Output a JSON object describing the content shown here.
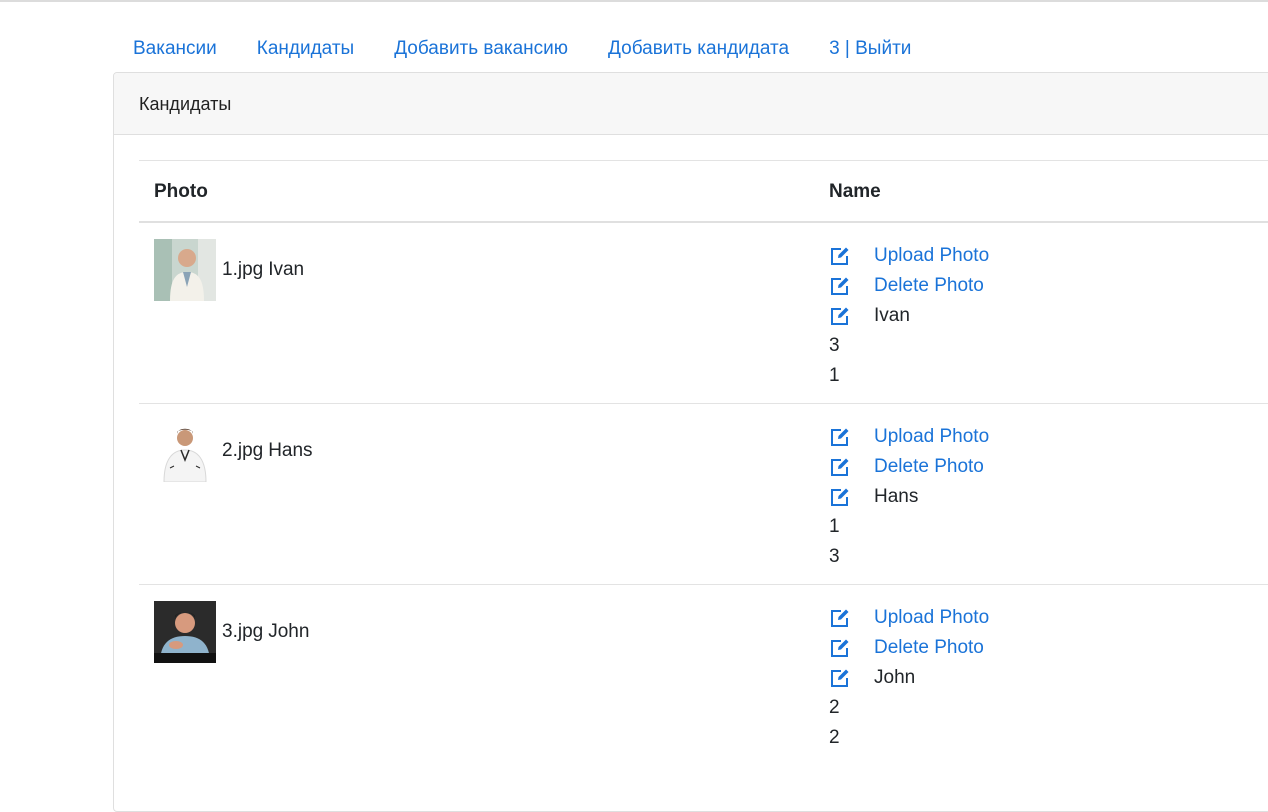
{
  "nav": {
    "items": [
      "Вакансии",
      "Кандидаты",
      "Добавить вакансию",
      "Добавить кандидата",
      "3 | Выйти"
    ]
  },
  "card": {
    "title": "Кандидаты"
  },
  "table": {
    "headers": {
      "photo": "Photo",
      "name": "Name"
    },
    "rows": [
      {
        "file": "1.jpg",
        "person": "Ivan",
        "upload": "Upload Photo",
        "delete": "Delete Photo",
        "name": "Ivan",
        "val1": "3",
        "val2": "1"
      },
      {
        "file": "2.jpg",
        "person": "Hans",
        "upload": "Upload Photo",
        "delete": "Delete Photo",
        "name": "Hans",
        "val1": "1",
        "val2": "3"
      },
      {
        "file": "3.jpg",
        "person": "John",
        "upload": "Upload Photo",
        "delete": "Delete Photo",
        "name": "John",
        "val1": "2",
        "val2": "2"
      }
    ]
  },
  "icons": {
    "edit": "edit-icon"
  },
  "colors": {
    "link": "#1a73d8",
    "text": "#212529",
    "header_bg": "#f7f7f7"
  }
}
